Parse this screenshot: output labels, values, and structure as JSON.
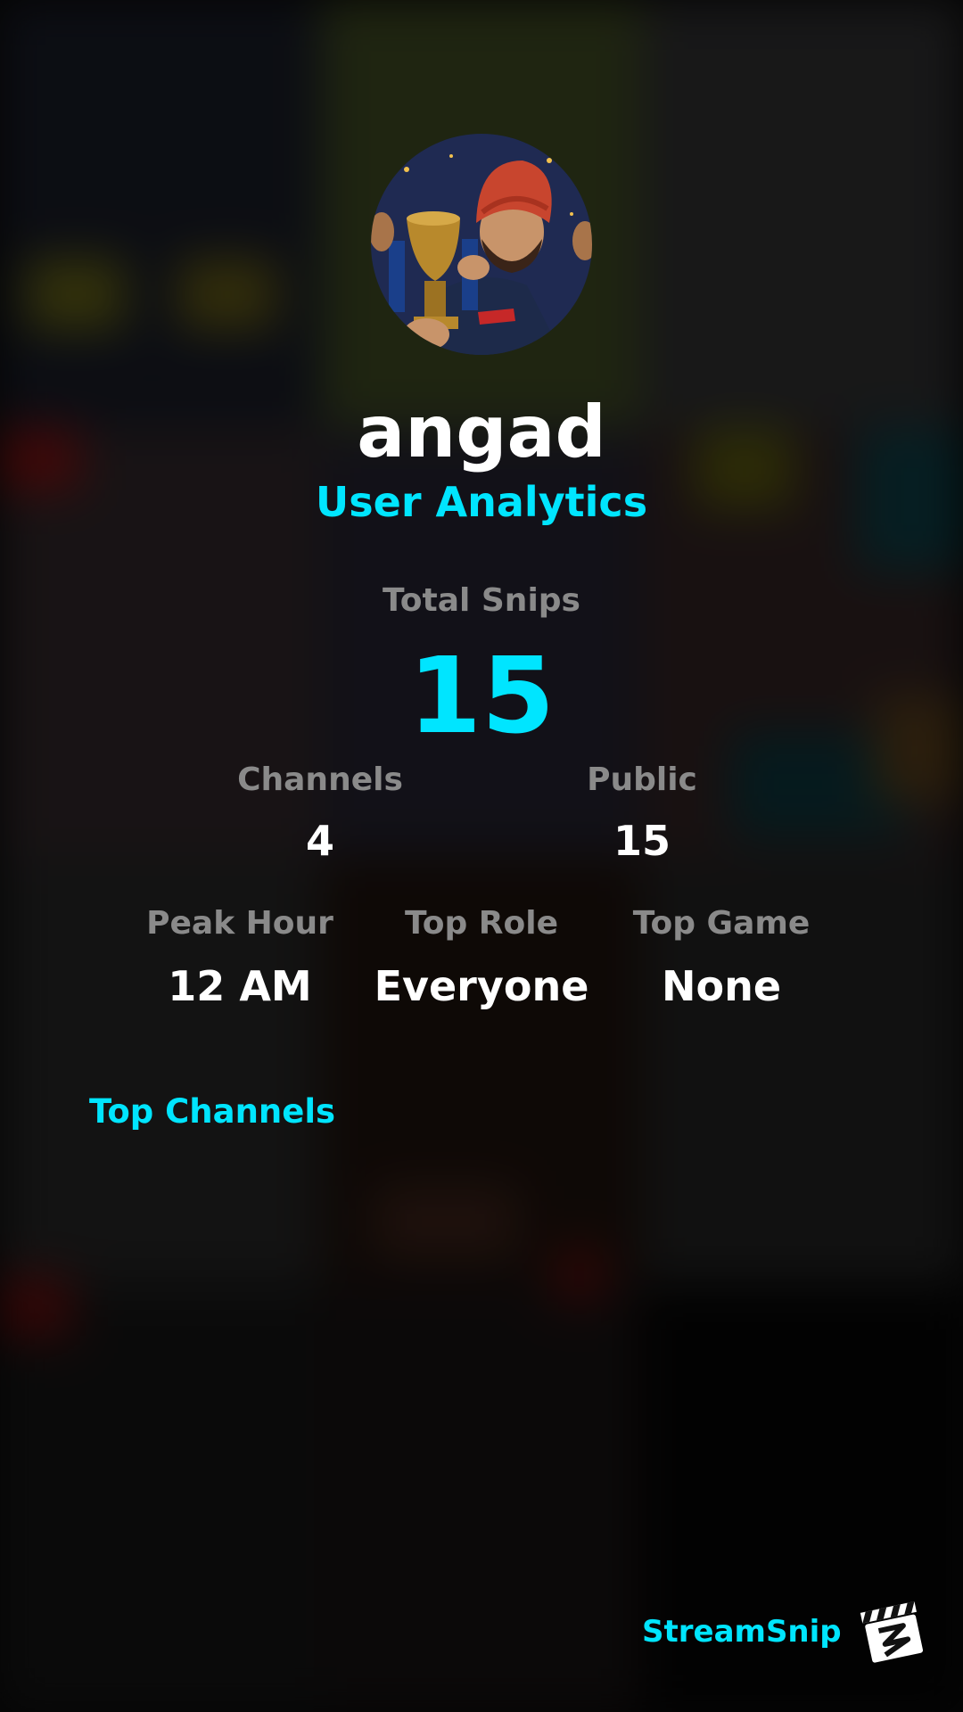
{
  "theme": {
    "accent": "#00e5ff",
    "muted": "#8a8a8a",
    "text": "#ffffff"
  },
  "profile": {
    "username": "angad",
    "subtitle": "User Analytics",
    "avatar": "profile-avatar-illustration"
  },
  "summary": {
    "total_label": "Total Snips",
    "total_value": "15"
  },
  "stats_row1": [
    {
      "label": "Channels",
      "value": "4"
    },
    {
      "label": "Public",
      "value": "15"
    }
  ],
  "stats_row2": [
    {
      "label": "Peak Hour",
      "value": "12 AM"
    },
    {
      "label": "Top Role",
      "value": "Everyone"
    },
    {
      "label": "Top Game",
      "value": "None"
    }
  ],
  "sections": {
    "top_channels_title": "Top Channels"
  },
  "footer": {
    "brand_name": "StreamSnip",
    "brand_icon": "clapperboard-logo-icon"
  }
}
